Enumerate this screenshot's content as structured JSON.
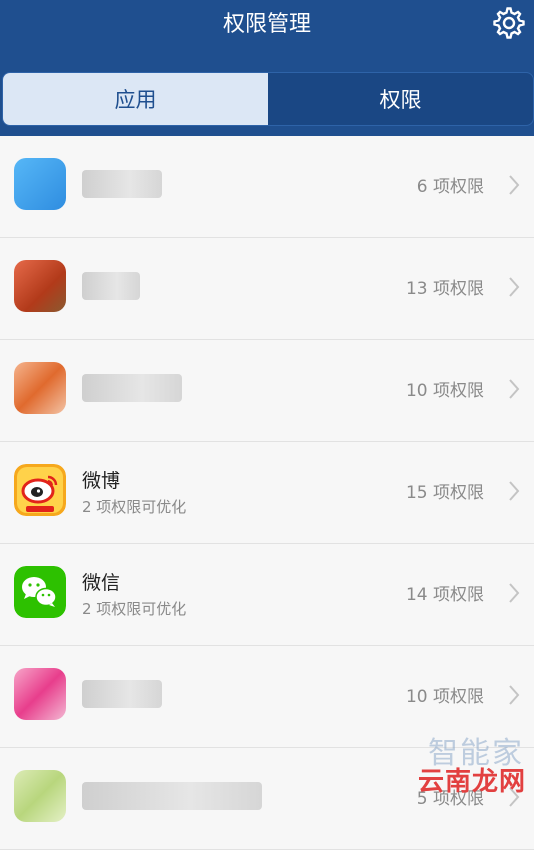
{
  "header": {
    "title": "权限管理",
    "settings_icon": "gear-icon"
  },
  "tabs": [
    {
      "label": "应用",
      "active": true
    },
    {
      "label": "权限",
      "active": false
    }
  ],
  "apps": [
    {
      "name": "",
      "sub": "",
      "count": "6 项权限",
      "icon_color": "#3a9ff0"
    },
    {
      "name": "",
      "sub": "",
      "count": "13 项权限",
      "icon_color": "#d84a2a"
    },
    {
      "name": "",
      "sub": "",
      "count": "10 项权限",
      "icon_color": "#ef8d5b"
    },
    {
      "name": "微博",
      "sub": "2 项权限可优化",
      "count": "15 项权限",
      "icon_color": "#f5a623"
    },
    {
      "name": "微信",
      "sub": "2 项权限可优化",
      "count": "14 项权限",
      "icon_color": "#2dc100"
    },
    {
      "name": "",
      "sub": "",
      "count": "10 项权限",
      "icon_color": "#e83e8c"
    },
    {
      "name": "",
      "sub": "",
      "count": "5 项权限",
      "icon_color": "#c5dd8e"
    }
  ],
  "watermark": {
    "text": "云南龙网",
    "faded": "智能家"
  }
}
